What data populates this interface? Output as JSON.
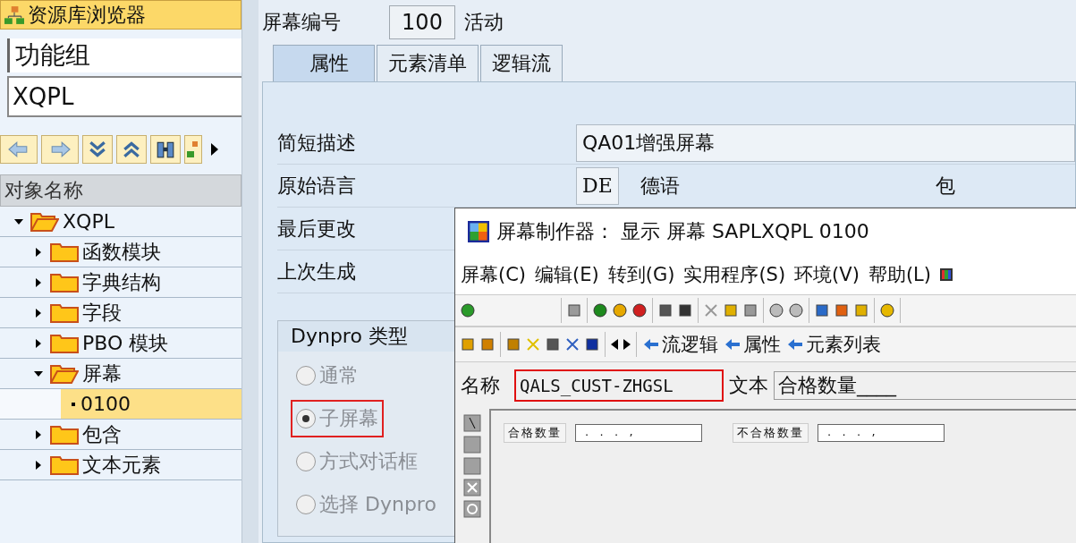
{
  "sidebar": {
    "title": "资源库浏览器",
    "object_type": "功能组",
    "object_name": "XQPL",
    "column_header": "对象名称",
    "tree": [
      {
        "label": "XQPL",
        "expanded": true,
        "selected": false,
        "children": [
          {
            "label": "函数模块",
            "expanded": false,
            "selected": false
          },
          {
            "label": "字典结构",
            "expanded": false,
            "selected": false
          },
          {
            "label": "字段",
            "expanded": false,
            "selected": false
          },
          {
            "label": "PBO 模块",
            "expanded": false,
            "selected": false
          },
          {
            "label": "屏幕",
            "expanded": true,
            "selected": false,
            "children": [
              {
                "label": "0100",
                "selected": true
              }
            ]
          },
          {
            "label": "包含",
            "expanded": false,
            "selected": false
          },
          {
            "label": "文本元素",
            "expanded": false,
            "selected": false
          }
        ]
      }
    ]
  },
  "screen": {
    "number_label": "屏幕编号",
    "number": "100",
    "status": "活动",
    "tabs": [
      {
        "label": "属性",
        "selected": true
      },
      {
        "label": "元素清单",
        "selected": false
      },
      {
        "label": "逻辑流",
        "selected": false
      }
    ],
    "fields": [
      {
        "label": "简短描述",
        "value": "QA01增强屏幕"
      },
      {
        "label": "原始语言",
        "value": "DE",
        "extra": "德语",
        "extra2": "包"
      },
      {
        "label": "最后更改"
      },
      {
        "label": "上次生成"
      }
    ],
    "dynpro_type": {
      "title": "Dynpro 类型",
      "options": [
        {
          "label": "通常",
          "selected": false,
          "disabled": true,
          "highlighted": false
        },
        {
          "label": "子屏幕",
          "selected": true,
          "disabled": true,
          "highlighted": true
        },
        {
          "label": "方式对话框",
          "selected": false,
          "disabled": true,
          "highlighted": false
        },
        {
          "label": "选择 Dynpro",
          "selected": false,
          "disabled": true,
          "highlighted": false
        }
      ]
    }
  },
  "painter": {
    "title": "屏幕制作器：  显示 屏幕 SAPLXQPL 0100",
    "menu": [
      "屏幕(C)",
      "编辑(E)",
      "转到(G)",
      "实用程序(S)",
      "环境(V)",
      "帮助(L)"
    ],
    "nav_links": [
      "流逻辑",
      "属性",
      "元素列表"
    ],
    "name_label": "名称",
    "name_value": "QALS_CUST-ZHGSL",
    "name_highlighted": true,
    "text_label": "文本",
    "text_value": "合格数量____",
    "canvas_items": [
      {
        "label": "合格数量",
        "value": ".   .   .   ,"
      },
      {
        "label": "不合格数量",
        "value": ".   .   .   ,"
      }
    ]
  }
}
